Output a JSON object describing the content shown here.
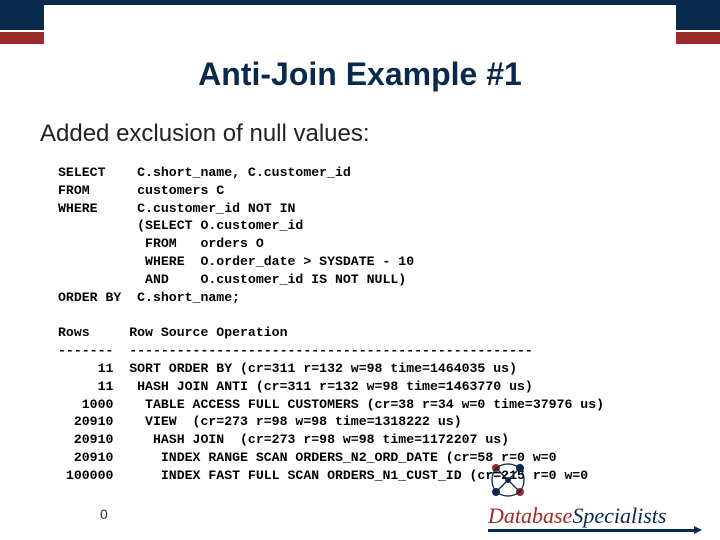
{
  "title": "Anti-Join Example #1",
  "subtitle": "Added exclusion of null values:",
  "sql": "SELECT    C.short_name, C.customer_id\nFROM      customers C\nWHERE     C.customer_id NOT IN\n          (SELECT O.customer_id\n           FROM   orders O\n           WHERE  O.order_date > SYSDATE - 10\n           AND    O.customer_id IS NOT NULL)\nORDER BY  C.short_name;",
  "plan_header": "Rows     Row Source Operation\n-------  ---------------------------------------------------",
  "plan_rows": [
    "     11  SORT ORDER BY (cr=311 r=132 w=98 time=1464035 us)",
    "     11   HASH JOIN ANTI (cr=311 r=132 w=98 time=1463770 us)",
    "   1000    TABLE ACCESS FULL CUSTOMERS (cr=38 r=34 w=0 time=37976 us)",
    "  20910    VIEW  (cr=273 r=98 w=98 time=1318222 us)",
    "  20910     HASH JOIN  (cr=273 r=98 w=98 time=1172207 us)",
    "  20910      INDEX RANGE SCAN ORDERS_N2_ORD_DATE (cr=58 r=0 w=0",
    " 100000      INDEX FAST FULL SCAN ORDERS_N1_CUST_ID (cr=215 r=0 w=0"
  ],
  "page_number": "0",
  "logo": {
    "word1": "Database",
    "word2": "Specialists"
  }
}
